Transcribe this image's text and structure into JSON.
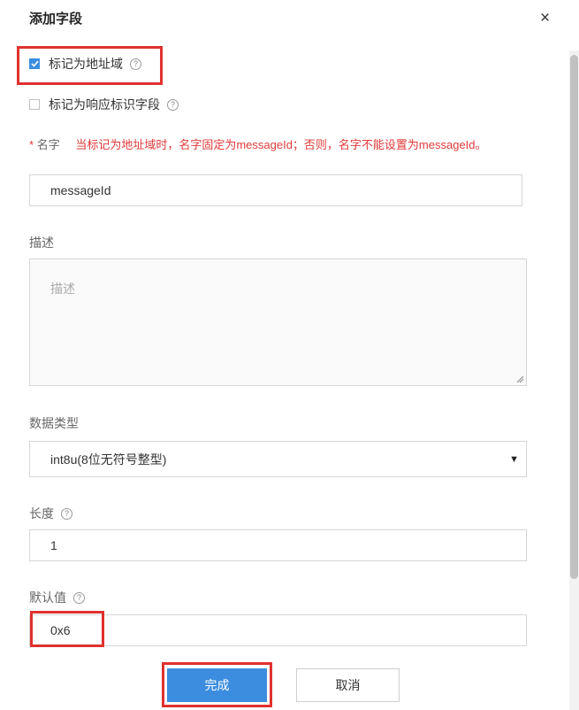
{
  "dialog": {
    "title": "添加字段",
    "close_symbol": "×"
  },
  "options": {
    "address_domain": {
      "label": "标记为地址域",
      "checked": true,
      "help": "?"
    },
    "response_id": {
      "label": "标记为响应标识字段",
      "checked": false,
      "help": "?"
    }
  },
  "name_field": {
    "required_mark": "*",
    "label": "名字",
    "warning": "当标记为地址域时，名字固定为messageId；否则，名字不能设置为messageId。",
    "value": "messageId"
  },
  "description_field": {
    "label": "描述",
    "placeholder": "描述"
  },
  "data_type_field": {
    "label": "数据类型",
    "selected": "int8u(8位无符号整型)",
    "caret": "▼"
  },
  "length_field": {
    "label": "长度",
    "help": "?",
    "value": "1"
  },
  "default_field": {
    "label": "默认值",
    "help": "?",
    "value": "0x6"
  },
  "buttons": {
    "confirm": "完成",
    "cancel": "取消"
  },
  "colors": {
    "accent": "#3c8de0",
    "highlight": "#e0312e",
    "warning_text": "#e03a3a"
  },
  "icons": [
    "close-icon",
    "checkbox-icon",
    "help-icon",
    "resize-handle-icon",
    "dropdown-caret-icon"
  ]
}
